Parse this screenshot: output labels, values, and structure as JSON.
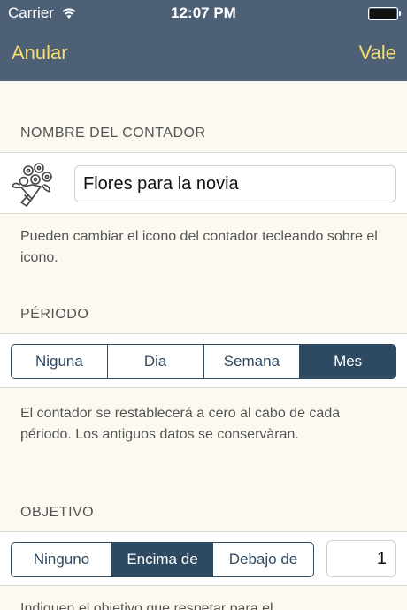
{
  "status_bar": {
    "carrier": "Carrier",
    "time": "12:07 PM"
  },
  "nav": {
    "cancel_label": "Anular",
    "ok_label": "Vale"
  },
  "name_section": {
    "header": "NOMBRE  DEL CONTADOR",
    "icon": "flower-bouquet-icon",
    "value": "Flores para la novia",
    "footer": "Pueden cambiar el icono del contador tecleando sobre el icono."
  },
  "period_section": {
    "header": "PÉRIODO",
    "options": [
      "Niguna",
      "Dia",
      "Semana",
      "Mes"
    ],
    "selected": "Mes",
    "footer": "El contador se restablecerá a cero al cabo de cada périodo. Los antiguos datos se conservàran."
  },
  "objective_section": {
    "header": "OBJETIVO",
    "options": [
      "Ninguno",
      "Encima de",
      "Debajo de"
    ],
    "selected": "Encima de",
    "target_value": "1",
    "footer": "Indiquen el objetivo que respetar para el"
  },
  "colors": {
    "nav_background": "#4d6076",
    "nav_button": "#f7df6a",
    "segment_accent": "#2e4a63",
    "page_background": "#fcfaf0"
  }
}
